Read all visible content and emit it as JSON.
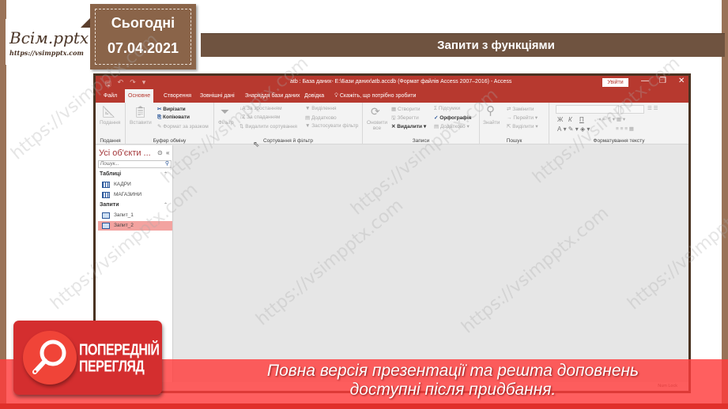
{
  "branding": {
    "logo_title": "Всім.pptx",
    "logo_url": "https://vsimpptx.com"
  },
  "date_tag": {
    "label": "Сьогодні",
    "date": "07.04.2021"
  },
  "slide": {
    "title": "Запити з функціями"
  },
  "access_window": {
    "title": "atb : База даних- E:\\Бази даних\\atb.accdb (Формат файлів Access 2007–2016)  -  Access",
    "login_label": "Увійти",
    "controls": {
      "minimize": "—",
      "restore": "❐",
      "close": "✕"
    },
    "qat_icons": [
      "save-icon",
      "undo-icon",
      "redo-icon",
      "customize-icon"
    ],
    "tabs": [
      {
        "label": "Файл",
        "active": false
      },
      {
        "label": "Основне",
        "active": true
      },
      {
        "label": "Створення",
        "active": false
      },
      {
        "label": "Зовнішні дані",
        "active": false
      },
      {
        "label": "Знаряддя бази даних",
        "active": false
      },
      {
        "label": "Довідка",
        "active": false
      }
    ],
    "tell_me": "Скажіть, що потрібно зробити",
    "ribbon": {
      "groups": [
        {
          "label": "Подання",
          "buttons": [
            "Подання"
          ]
        },
        {
          "label": "Буфер обміну",
          "buttons": [
            "Вставити",
            "Вирізати",
            "Копіювати",
            "Формат за зразком"
          ]
        },
        {
          "label": "Сортування й фільтр",
          "buttons": [
            "Фільтр",
            "За зростанням",
            "За спаданням",
            "Видалити сортування",
            "Виділення",
            "Додатково",
            "Застосувати фільтр"
          ]
        },
        {
          "label": "Записи",
          "buttons": [
            "Оновити все",
            "Створити",
            "Зберегти",
            "Видалити",
            "Підсумки",
            "Орфографія",
            "Додатково"
          ]
        },
        {
          "label": "Пошук",
          "buttons": [
            "Знайти",
            "Замінити",
            "Перейти",
            "Виділити"
          ]
        },
        {
          "label": "Форматування тексту",
          "buttons": [
            "Ж",
            "К",
            "П",
            "А"
          ]
        }
      ]
    },
    "nav_pane": {
      "header": "Усі об'єкти ...",
      "search_placeholder": "Пошук...",
      "sections": [
        {
          "label": "Таблиці",
          "items": [
            {
              "label": "КАДРИ",
              "selected": false
            },
            {
              "label": "МАГАЗИНИ",
              "selected": false
            }
          ]
        },
        {
          "label": "Запити",
          "items": [
            {
              "label": "Запит_1",
              "selected": false
            },
            {
              "label": "Запит_2",
              "selected": true
            }
          ]
        }
      ]
    },
    "status_bar": {
      "num_lock": "Num Lock"
    }
  },
  "preview_overlay": {
    "badge_line1": "ПОПЕРЕДНІЙ",
    "badge_line2": "ПЕРЕГЛЯД",
    "message_line1": "Повна версія презентації та решта доповнень",
    "message_line2": "доступні після придбання."
  },
  "watermark": "https://vsimpptx.com",
  "colors": {
    "brown_frame": "#9a7358",
    "title_bar": "#6f5340",
    "access_red": "#b7392f",
    "overlay_red": "#ff3c3c",
    "nav_selected": "#f3a3a0"
  }
}
